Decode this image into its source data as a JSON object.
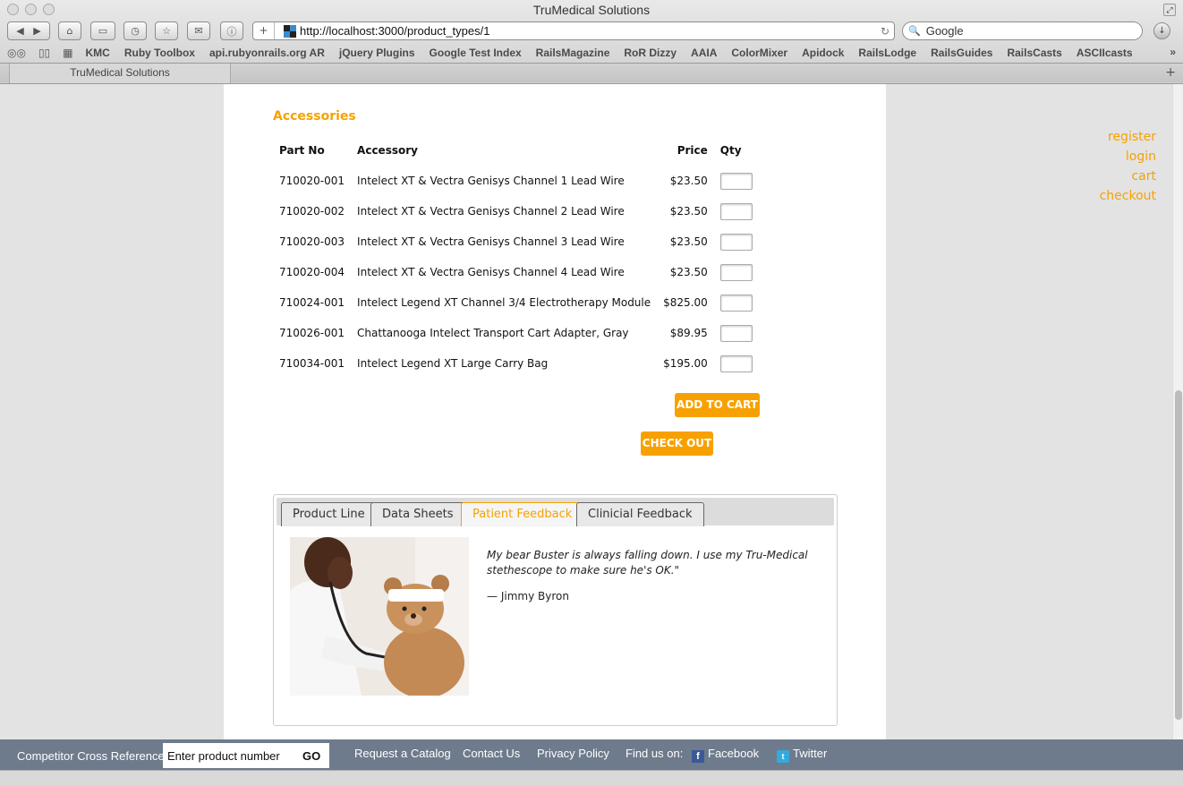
{
  "window": {
    "title": "TruMedical Solutions"
  },
  "address_bar": {
    "url": "http://localhost:3000/product_types/1"
  },
  "search_bar": {
    "placeholder": "Google"
  },
  "bookmarks": [
    "KMC",
    "Ruby Toolbox",
    "api.rubyonrails.org AR",
    "jQuery Plugins",
    "Google Test Index",
    "RailsMagazine",
    "RoR Dizzy",
    "AAIA",
    "ColorMixer",
    "Apidock",
    "RailsLodge",
    "RailsGuides",
    "RailsCasts",
    "ASCIIcasts"
  ],
  "tab": {
    "title": "TruMedical Solutions"
  },
  "user_links": {
    "register": "register",
    "login": "login",
    "cart": "cart",
    "checkout": "checkout"
  },
  "accessories": {
    "title": "Accessories",
    "headers": {
      "part_no": "Part No",
      "accessory": "Accessory",
      "price": "Price",
      "qty": "Qty"
    },
    "rows": [
      {
        "part_no": "710020-001",
        "name": "Intelect XT & Vectra Genisys Channel 1 Lead Wire",
        "price": "$23.50"
      },
      {
        "part_no": "710020-002",
        "name": "Intelect XT & Vectra Genisys Channel 2 Lead Wire",
        "price": "$23.50"
      },
      {
        "part_no": "710020-003",
        "name": "Intelect XT & Vectra Genisys Channel 3 Lead Wire",
        "price": "$23.50"
      },
      {
        "part_no": "710020-004",
        "name": "Intelect XT & Vectra Genisys Channel 4 Lead Wire",
        "price": "$23.50"
      },
      {
        "part_no": "710024-001",
        "name": "Intelect Legend XT Channel 3/4 Electrotherapy Module",
        "price": "$825.00"
      },
      {
        "part_no": "710026-001",
        "name": "Chattanooga Intelect Transport Cart Adapter, Gray",
        "price": "$89.95"
      },
      {
        "part_no": "710034-001",
        "name": "Intelect Legend XT Large Carry Bag",
        "price": "$195.00"
      }
    ],
    "add_to_cart": "ADD TO CART",
    "check_out": "CHECK OUT"
  },
  "info_tabs": {
    "tabs": [
      "Product Line",
      "Data Sheets",
      "Patient Feedback",
      "Clinicial Feedback"
    ],
    "active": "Patient Feedback",
    "testimonial": {
      "quote": "My bear Buster is always falling down. I use my Tru-Medical stethescope to make sure he's OK.\"",
      "author": "— Jimmy Byron"
    }
  },
  "footer": {
    "cross_ref_label": "Competitor Cross Reference:",
    "cross_ref_value": "Enter product number",
    "go": "GO",
    "request_catalog": "Request a Catalog",
    "contact": "Contact Us",
    "privacy": "Privacy Policy",
    "find_us": "Find us on:",
    "facebook": "Facebook",
    "twitter": "Twitter"
  },
  "colors": {
    "accent": "#f7a100",
    "footer_bg": "#6d7b8c"
  }
}
